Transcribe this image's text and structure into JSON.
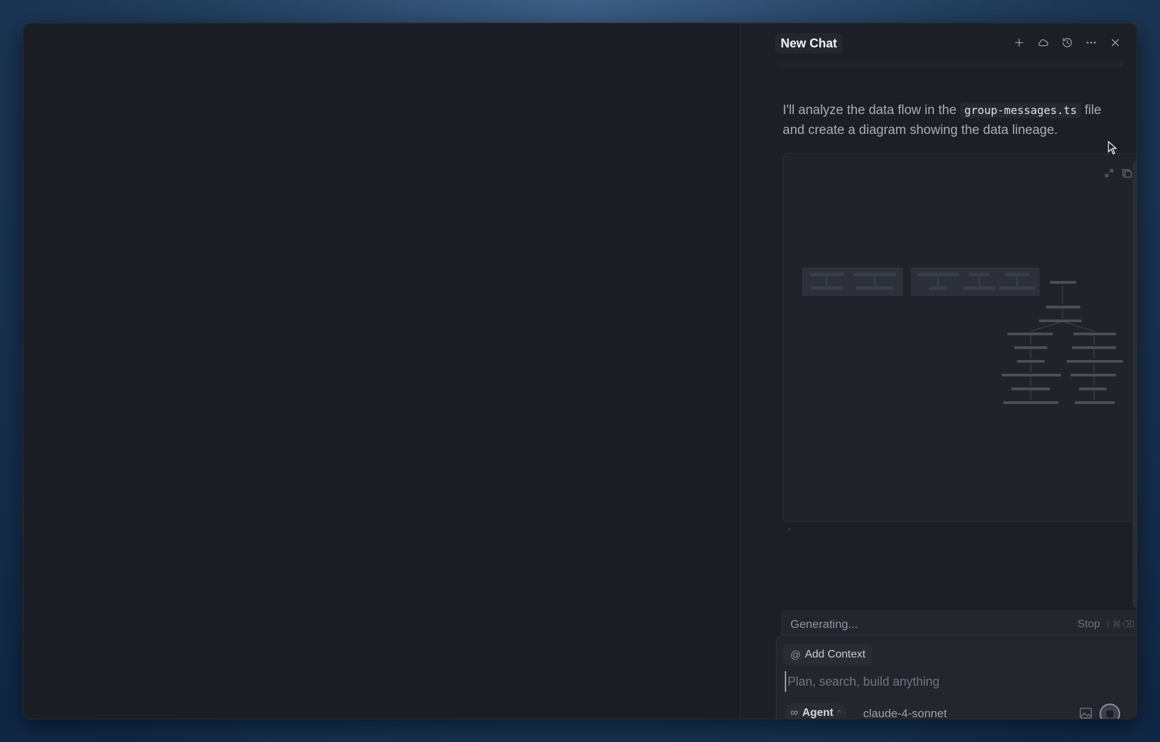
{
  "chat": {
    "title": "New Chat",
    "header_icons": [
      "plus-icon",
      "cloud-icon",
      "history-icon",
      "more-icon",
      "close-icon"
    ],
    "message": {
      "before": "I'll analyze the data flow in the",
      "code": "group-messages.ts",
      "after": "file and create a diagram showing the data lineage."
    },
    "status": {
      "text": "Generating...",
      "stop_label": "Stop",
      "stop_shortcut": "⇧⌘⌫"
    },
    "composer": {
      "add_context": "Add Context",
      "placeholder": "Plan, search, build anything",
      "mode": "Agent",
      "model": "claude-4-sonnet"
    }
  }
}
